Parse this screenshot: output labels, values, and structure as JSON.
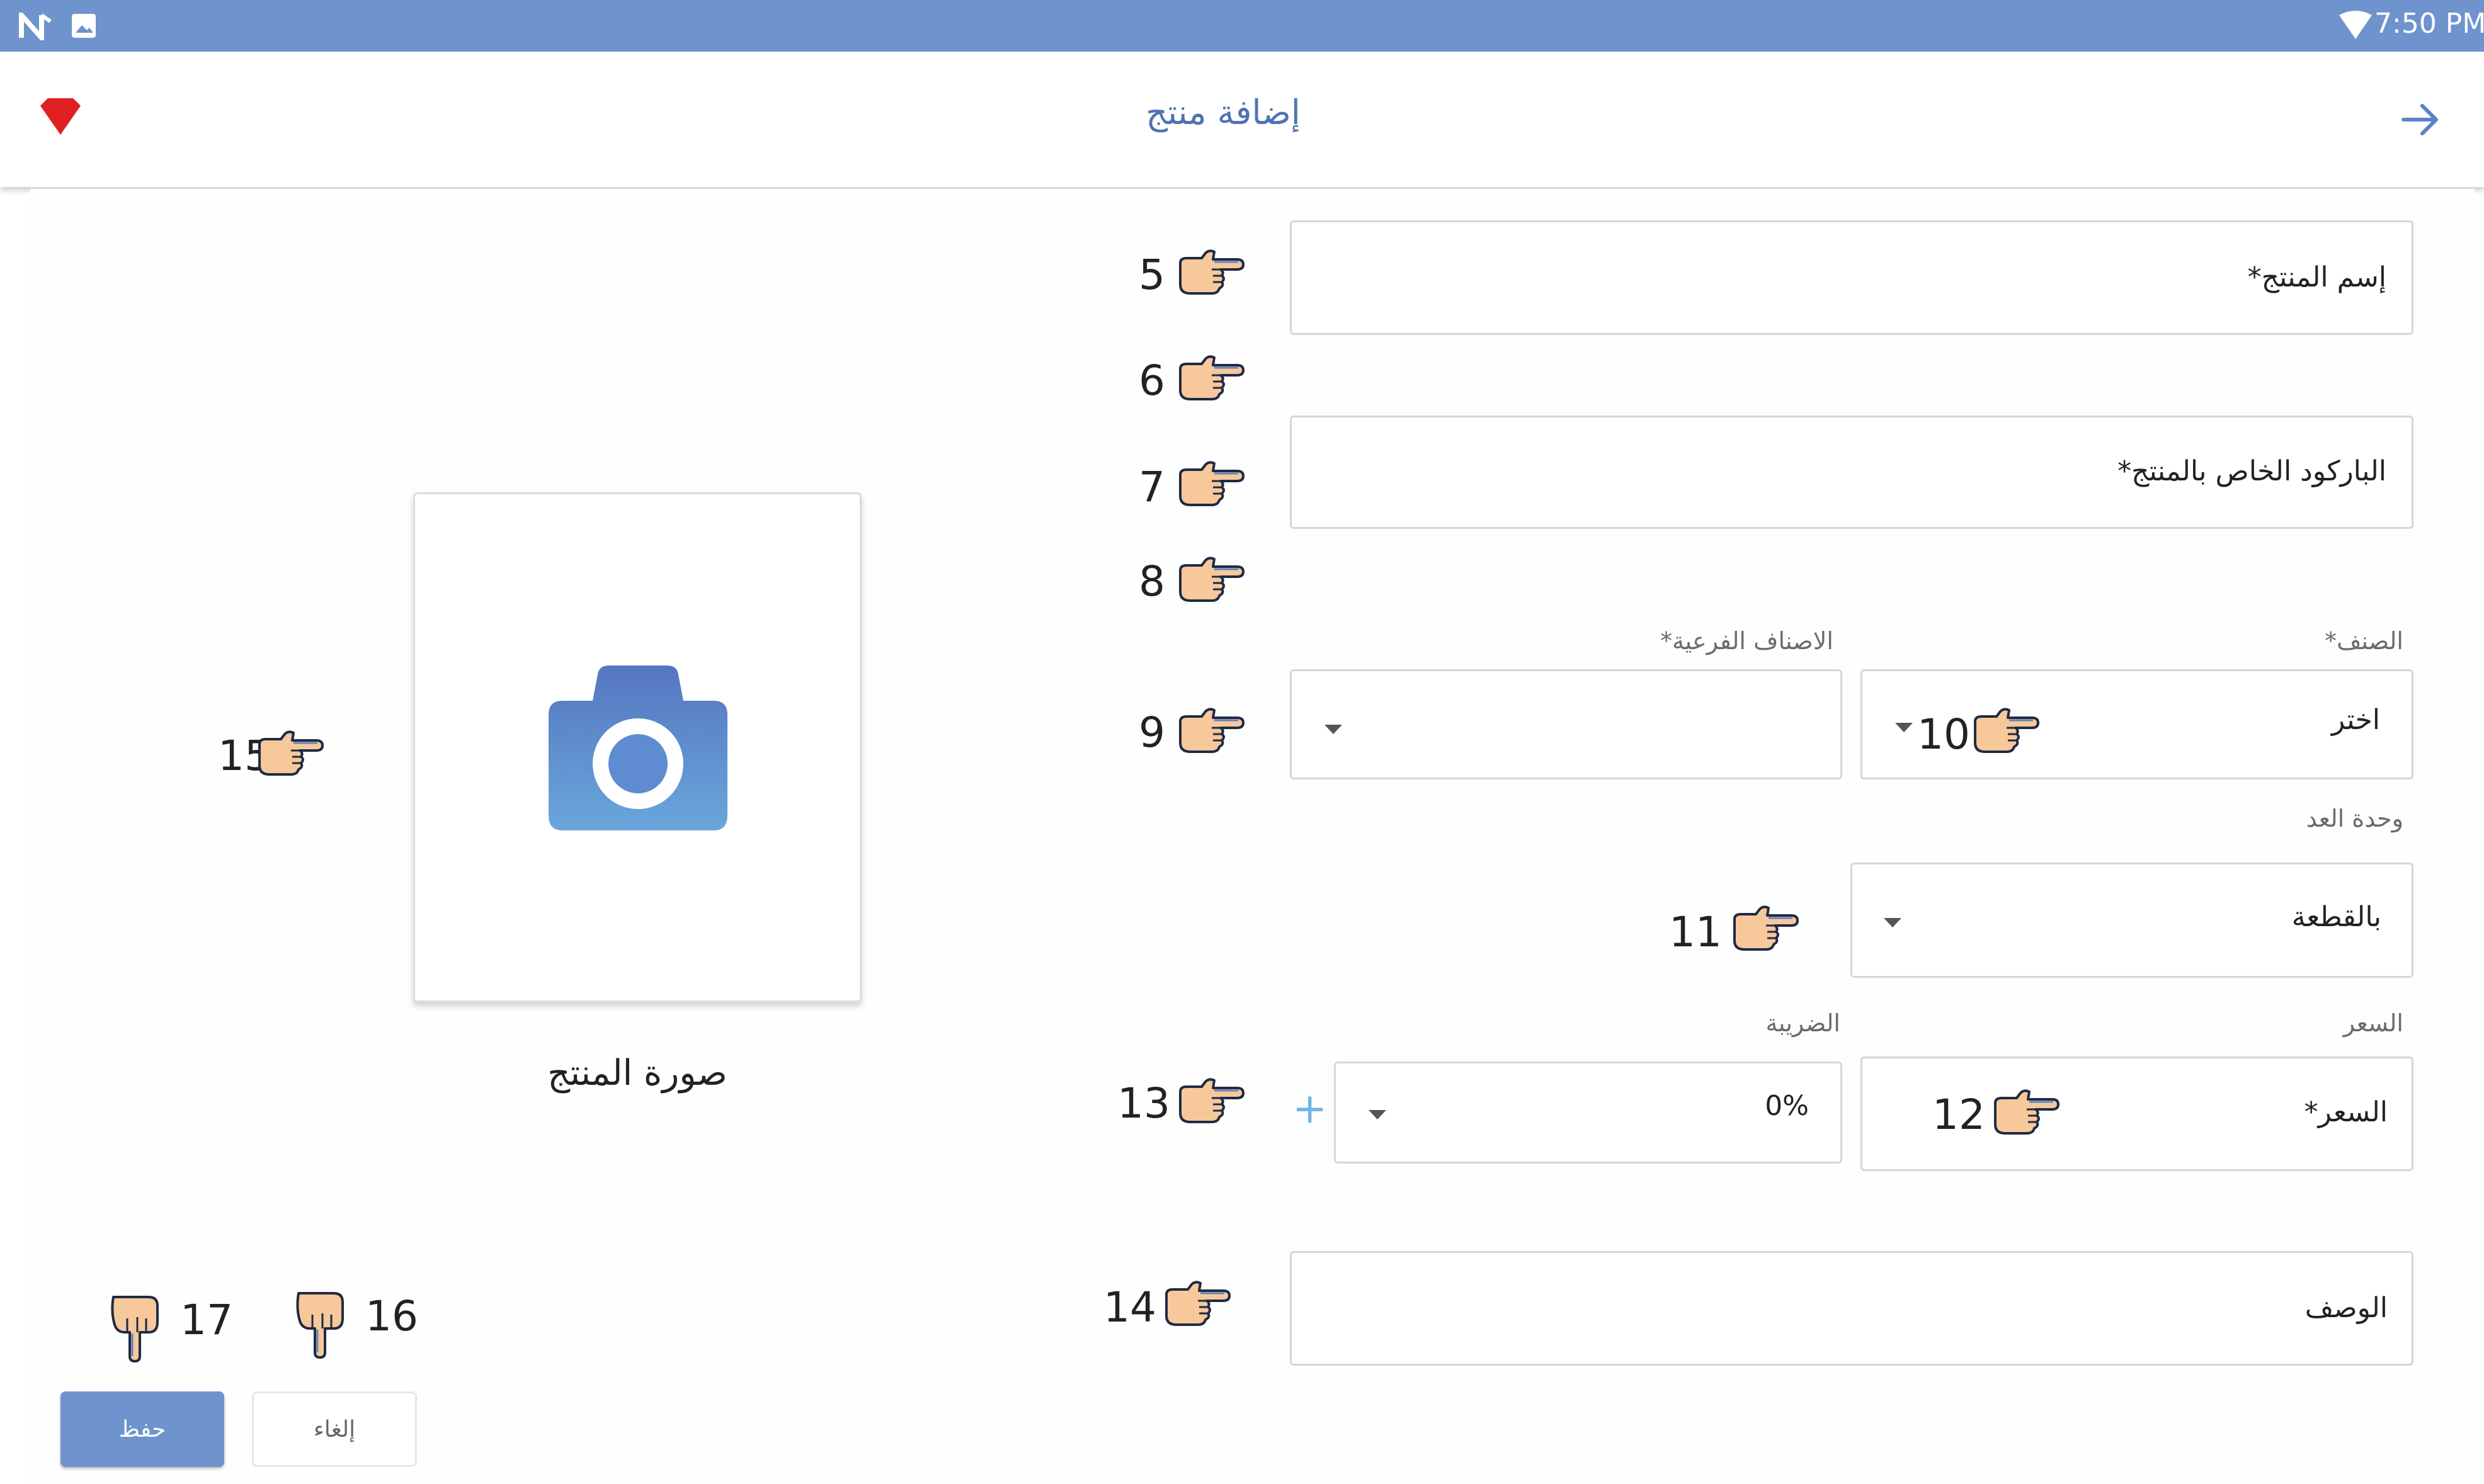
{
  "status_bar": {
    "time": "7:50 PM",
    "left_icons": [
      "n-logo-icon",
      "image-icon"
    ],
    "right_icons": [
      "wifi-icon"
    ]
  },
  "app_bar": {
    "title": "إضافة منتج",
    "back_icon": "arrow-forward-icon",
    "badge_icon": "red-gem-icon"
  },
  "form": {
    "product_name": {
      "placeholder": "إسم المنتج*"
    },
    "barcode": {
      "placeholder": "الباركود الخاص بالمنتج*"
    },
    "category": {
      "label": "الصنف*",
      "value": "اختر"
    },
    "subcategories": {
      "label": "الاصناف الفرعية*",
      "value": ""
    },
    "unit": {
      "label": "وحدة العد",
      "value": "بالقطعة"
    },
    "price": {
      "label": "السعر",
      "placeholder": "السعر*"
    },
    "tax": {
      "label": "الضريبة",
      "value": "0%",
      "add_symbol": "+"
    },
    "description": {
      "placeholder": "الوصف"
    }
  },
  "photo": {
    "caption": "صورة المنتج",
    "icon": "camera-icon"
  },
  "annotations": [
    "5",
    "6",
    "7",
    "8",
    "9",
    "10",
    "11",
    "12",
    "13",
    "14",
    "15",
    "16",
    "17"
  ],
  "buttons": {
    "save": "حفظ",
    "cancel": "إلغاء"
  },
  "colors": {
    "status_bar": "#6f93cd",
    "title": "#4f72b5",
    "save_button": "#6f93cd",
    "camera": "#5b83c7",
    "gem": "#e02020"
  }
}
